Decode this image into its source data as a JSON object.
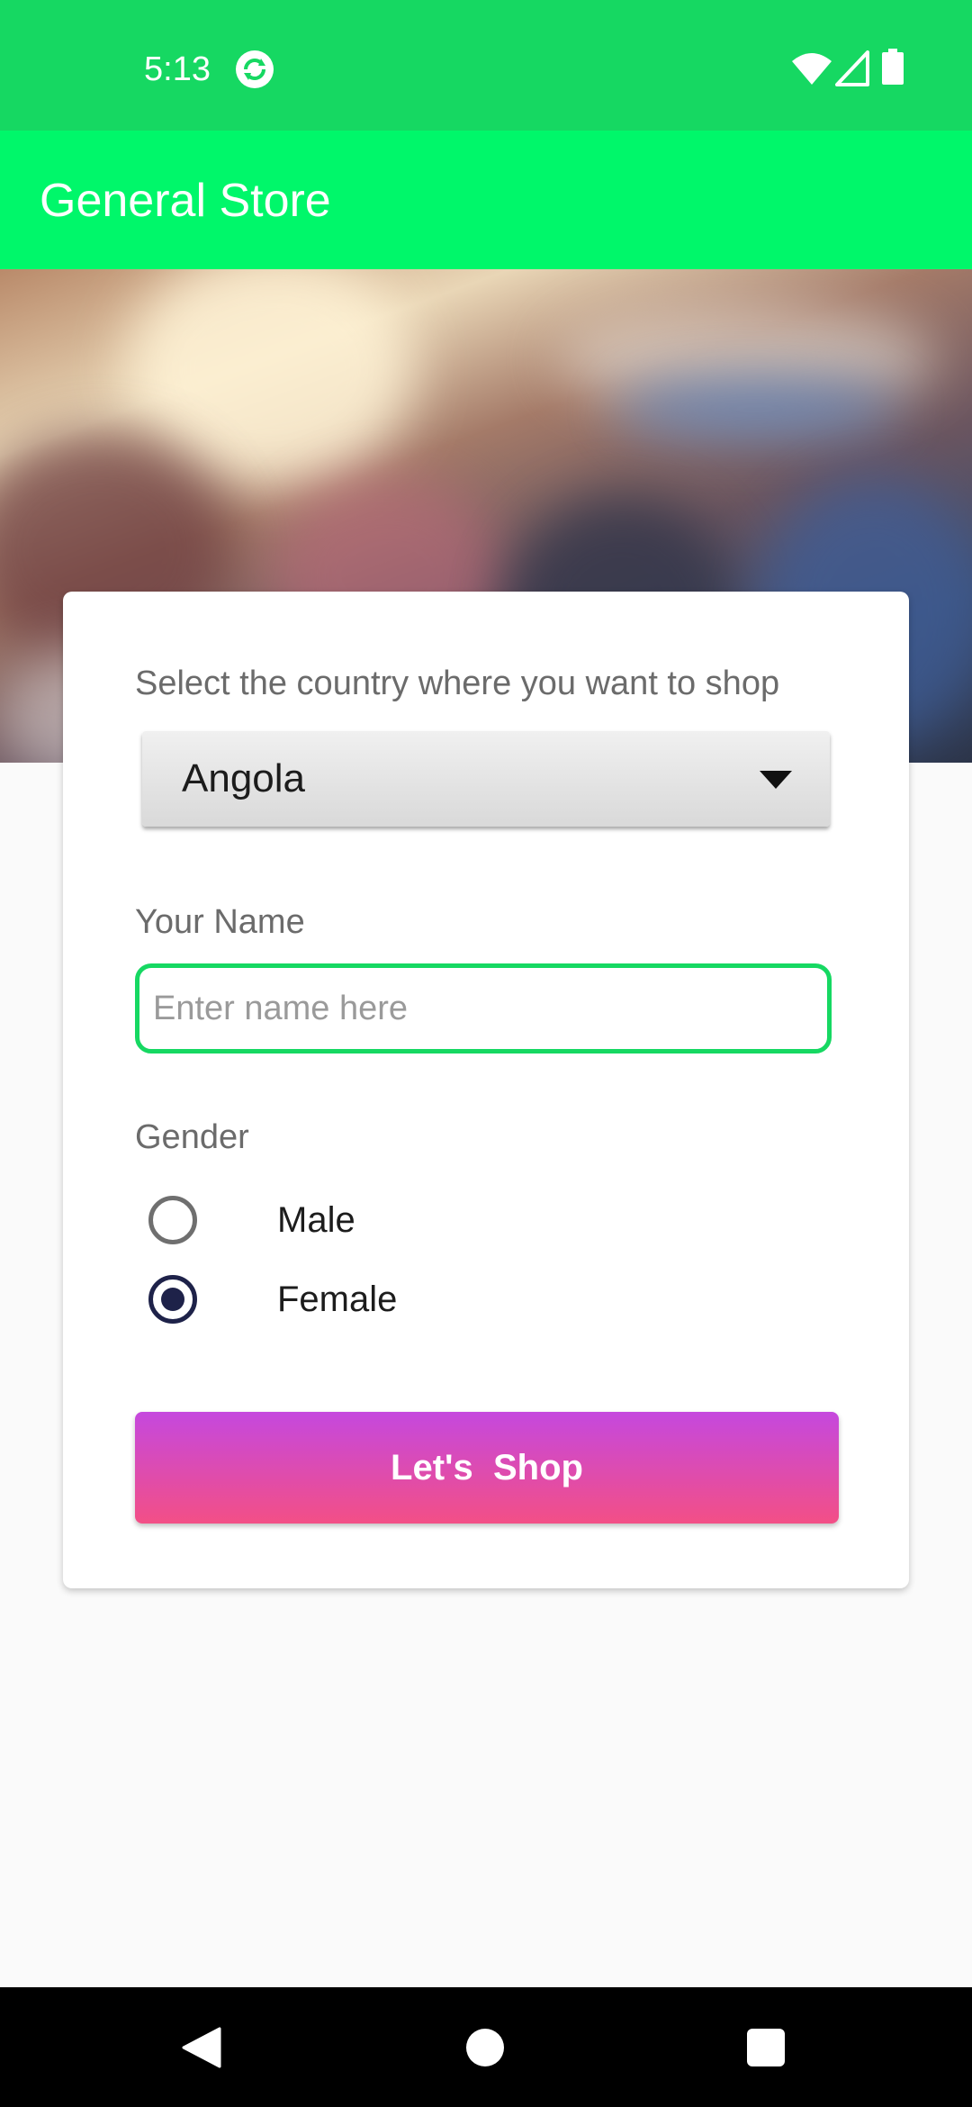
{
  "status_bar": {
    "time": "5:13",
    "icons": [
      "sync-icon",
      "wifi-icon",
      "signal-icon",
      "battery-icon"
    ]
  },
  "app_bar": {
    "title": "General Store"
  },
  "form": {
    "country_label": "Select the country where you want to shop",
    "country_selected": "Angola",
    "name_label": "Your Name",
    "name_value": "",
    "name_placeholder": "Enter name here",
    "gender_label": "Gender",
    "gender_options": [
      {
        "label": "Male",
        "checked": false
      },
      {
        "label": "Female",
        "checked": true
      }
    ],
    "submit_label": "Let's  Shop"
  },
  "nav_bar": {
    "icons": [
      "back-icon",
      "home-icon",
      "recents-icon"
    ]
  },
  "colors": {
    "status_bar": "#16d862",
    "app_bar": "#00f76a",
    "input_border": "#16d862",
    "radio_checked": "#1e2249",
    "button_gradient_top": "#c548de",
    "button_gradient_bottom": "#f34f86"
  }
}
